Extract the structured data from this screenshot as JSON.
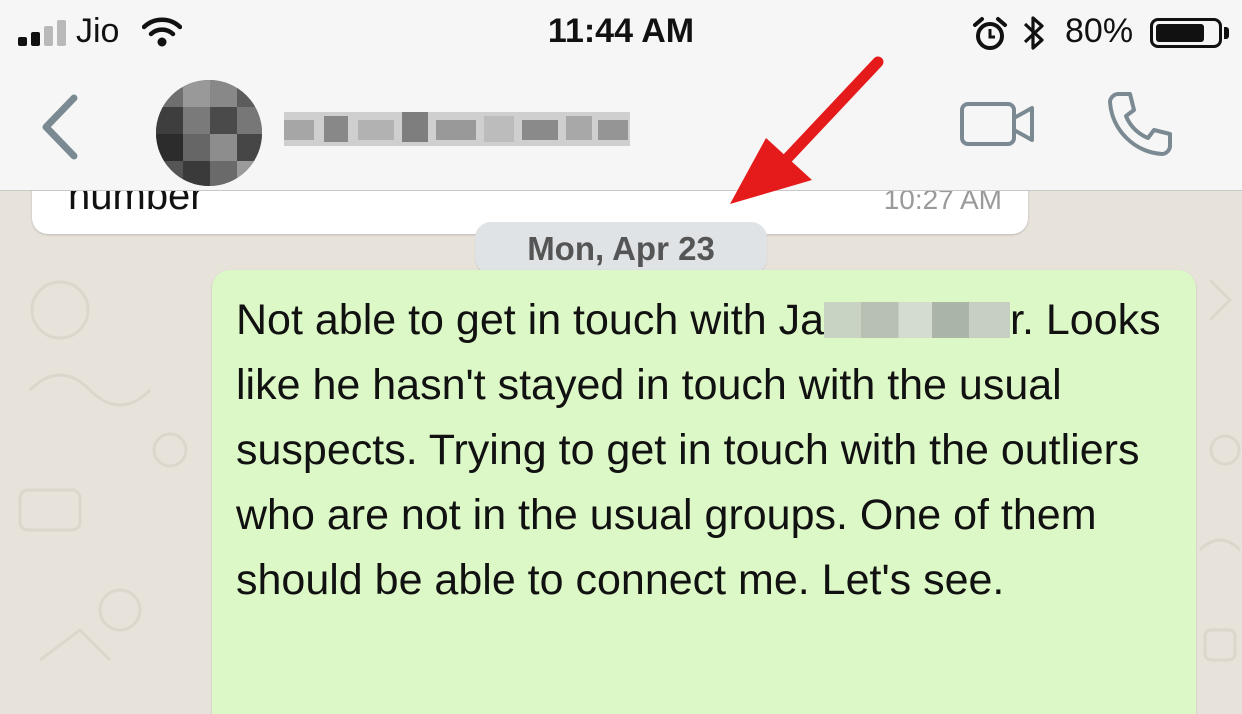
{
  "status_bar": {
    "carrier": "Jio",
    "time": "11:44 AM",
    "battery_percent": "80%",
    "battery_level": 0.8,
    "icons": [
      "signal-icon",
      "wifi-icon",
      "alarm-icon",
      "bluetooth-icon",
      "battery-icon"
    ]
  },
  "nav_bar": {
    "icons": [
      "back-chevron-icon",
      "video-camera-icon",
      "phone-icon"
    ]
  },
  "chat": {
    "previous_message": {
      "text": "number",
      "time": "10:27 AM"
    },
    "date_separator": "Mon, Apr 23",
    "message": {
      "part1": "Not able to get in touch with Ja",
      "part2": "r. Looks like he hasn't stayed in touch with the usual suspects. Trying to get in touch with the outliers who are not in the usual groups. One of them should be able to connect me. Let's see."
    }
  },
  "colors": {
    "outgoing_bubble": "#dcf8c6",
    "incoming_bubble": "#ffffff",
    "accent_icon": "#7b8a92",
    "annotation_arrow": "#e51b1b"
  }
}
